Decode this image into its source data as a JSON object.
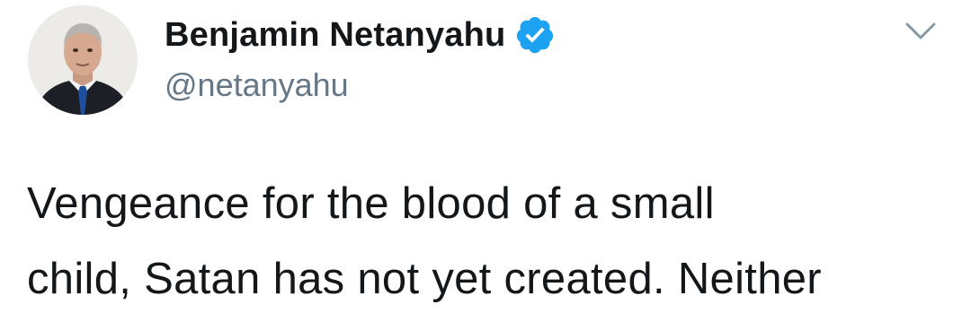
{
  "author": {
    "display_name": "Benjamin Netanyahu",
    "handle": "@netanyahu",
    "avatar_icon": "profile-photo",
    "verified_icon": "verified-badge-icon",
    "verified_color": "#1da1f2"
  },
  "menu": {
    "icon": "chevron-down-icon",
    "color": "#8899a6"
  },
  "tweet": {
    "lines": [
      "Vengeance for the blood of a small",
      "child, Satan has not yet created. Neither"
    ]
  }
}
